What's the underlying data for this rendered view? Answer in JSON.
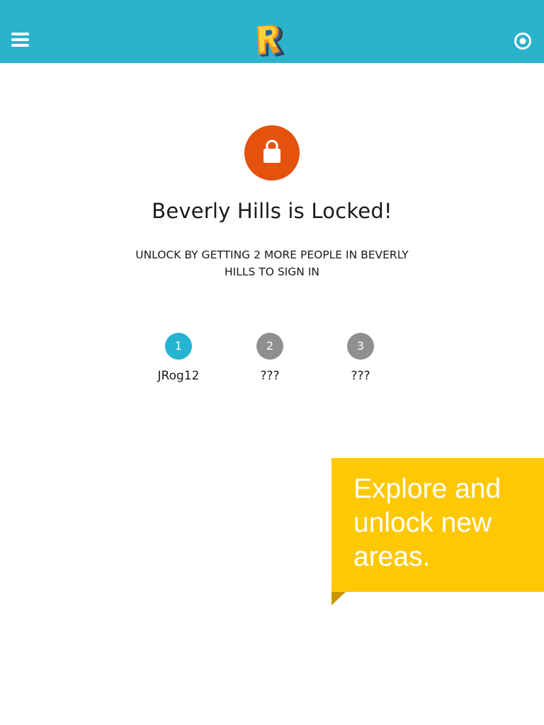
{
  "header": {
    "menu_icon": "hamburger-menu-icon",
    "logo_icon": "r-logo-icon",
    "target_icon": "target-icon",
    "logo_letter": "R",
    "bar_color": "#2ab3cb"
  },
  "lock": {
    "icon": "lock-icon",
    "color": "#e5520e"
  },
  "main": {
    "title": "Beverly Hills is Locked!",
    "subtitle": "UNLOCK BY GETTING 2 MORE PEOPLE IN BEVERLY HILLS TO SIGN IN"
  },
  "slots": [
    {
      "number": "1",
      "name": "JRog12",
      "state": "filled",
      "color": "#24b4d1"
    },
    {
      "number": "2",
      "name": "???",
      "state": "empty",
      "color": "#8f8f8f"
    },
    {
      "number": "3",
      "name": "???",
      "state": "empty",
      "color": "#8f8f8f"
    }
  ],
  "callout": {
    "text": "Explore and unlock new areas.",
    "color": "#ffc805"
  }
}
